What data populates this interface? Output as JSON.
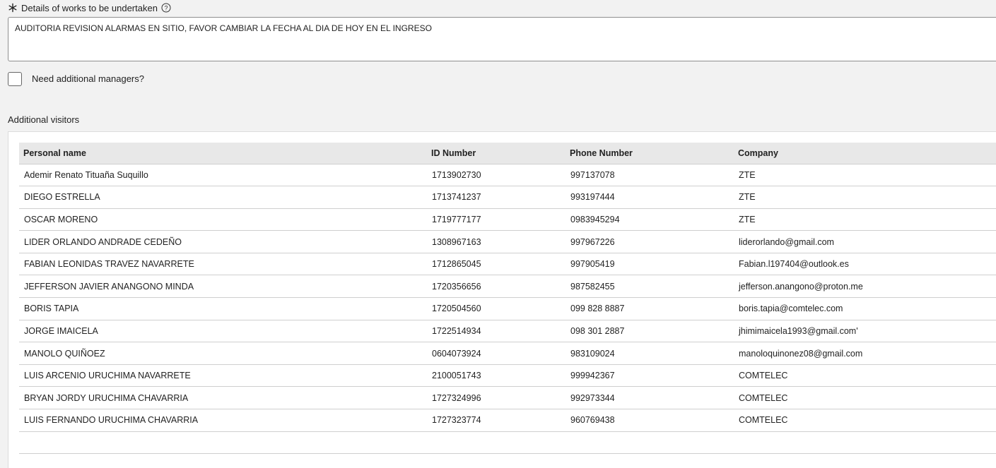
{
  "details": {
    "label": "Details of works to be undertaken",
    "required_icon": "asterisk-icon",
    "help_icon": "question-circle-icon",
    "value": "AUDITORIA REVISION ALARMAS EN SITIO, FAVOR CAMBIAR LA FECHA AL DIA DE HOY EN EL INGRESO"
  },
  "managers": {
    "label": "Need additional managers?",
    "checked": false
  },
  "visitors": {
    "title": "Additional visitors",
    "columns": [
      "Personal name",
      "ID Number",
      "Phone Number",
      "Company"
    ],
    "rows": [
      [
        "Ademir Renato Tituaña Suquillo",
        "1713902730",
        "997137078",
        "ZTE"
      ],
      [
        "DIEGO ESTRELLA",
        "1713741237",
        "993197444",
        "ZTE"
      ],
      [
        "OSCAR MORENO",
        "1719777177",
        "0983945294",
        "ZTE"
      ],
      [
        "LIDER ORLANDO ANDRADE CEDEÑO",
        "1308967163",
        "997967226",
        "liderorlando@gmail.com"
      ],
      [
        "FABIAN LEONIDAS TRAVEZ NAVARRETE",
        "1712865045",
        "997905419",
        "Fabian.l197404@outlook.es"
      ],
      [
        "JEFFERSON JAVIER ANANGONO MINDA",
        "1720356656",
        "987582455",
        "jefferson.anangono@proton.me"
      ],
      [
        "BORIS TAPIA",
        "1720504560",
        "099 828 8887",
        "boris.tapia@comtelec.com"
      ],
      [
        "JORGE IMAICELA",
        "1722514934",
        "098 301 2887",
        "jhimimaicela1993@gmail.com'"
      ],
      [
        "MANOLO QUIÑOEZ",
        "0604073924",
        "983109024",
        "manoloquinonez08@gmail.com"
      ],
      [
        "LUIS ARCENIO URUCHIMA NAVARRETE",
        "2100051743",
        "999942367",
        "COMTELEC"
      ],
      [
        "BRYAN JORDY URUCHIMA CHAVARRIA",
        "1727324996",
        "992973344",
        "COMTELEC"
      ],
      [
        "LUIS FERNANDO URUCHIMA CHAVARRIA",
        "1727323774",
        "960769438",
        "COMTELEC"
      ]
    ]
  }
}
